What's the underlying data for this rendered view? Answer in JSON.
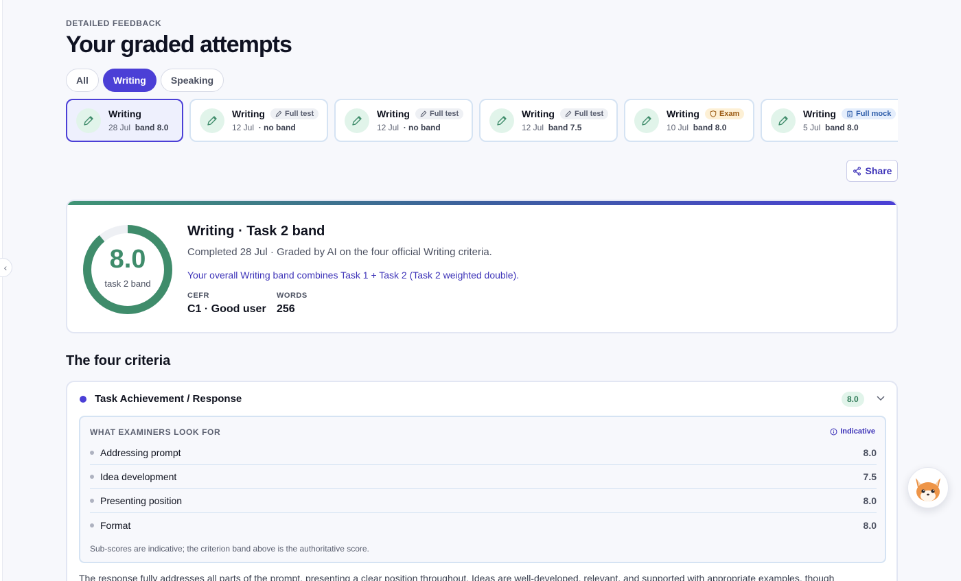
{
  "header": {
    "eyebrow": "DETAILED FEEDBACK",
    "title": "Your graded attempts"
  },
  "filters": [
    {
      "label": "All",
      "active": false
    },
    {
      "label": "Writing",
      "active": true
    },
    {
      "label": "Speaking",
      "active": false
    }
  ],
  "attempts": [
    {
      "title": "Writing",
      "tag": "",
      "date": "28 Jul",
      "band": "band 8.0",
      "active": true
    },
    {
      "title": "Writing",
      "tag": "Full test",
      "tag_type": "test",
      "date": "12 Jul",
      "band": "· no band"
    },
    {
      "title": "Writing",
      "tag": "Full test",
      "tag_type": "test",
      "date": "12 Jul",
      "band": "· no band"
    },
    {
      "title": "Writing",
      "tag": "Full test",
      "tag_type": "test",
      "date": "12 Jul",
      "band": "band 7.5"
    },
    {
      "title": "Writing",
      "tag": "Exam",
      "tag_type": "exam",
      "date": "10 Jul",
      "band": "band 8.0"
    },
    {
      "title": "Writing",
      "tag": "Full mock",
      "tag_type": "mock",
      "date": "5 Jul",
      "band": "band 8.0"
    }
  ],
  "share_label": "Share",
  "score": {
    "value": "8.0",
    "value_label": "task 2 band",
    "ring_fraction": 0.89,
    "title": "Writing · Task 2 band",
    "subtitle": "Completed 28 Jul · Graded by AI on the four official Writing criteria.",
    "note": "Your overall Writing band combines Task 1 + Task 2 (Task 2 weighted double).",
    "cefr_label": "CEFR",
    "cefr_value": "C1 · Good user",
    "words_label": "WORDS",
    "words_value": "256"
  },
  "criteria_section_title": "The four criteria",
  "criterion": {
    "name": "Task Achievement / Response",
    "band": "8.0",
    "examiners_header": "WHAT EXAMINERS LOOK FOR",
    "indicative_label": "Indicative",
    "subscores": [
      {
        "name": "Addressing prompt",
        "value": "8.0"
      },
      {
        "name": "Idea development",
        "value": "7.5"
      },
      {
        "name": "Presenting position",
        "value": "8.0"
      },
      {
        "name": "Format",
        "value": "8.0"
      }
    ],
    "subscore_note": "Sub-scores are indicative; the criterion band above is the authoritative score.",
    "description": "The response fully addresses all parts of the prompt, presenting a clear position throughout. Ideas are well-developed, relevant, and supported with appropriate examples, though"
  },
  "colors": {
    "accent": "#4b3fd6",
    "success": "#3f8c6b",
    "ring_track": "#eef0f4"
  }
}
